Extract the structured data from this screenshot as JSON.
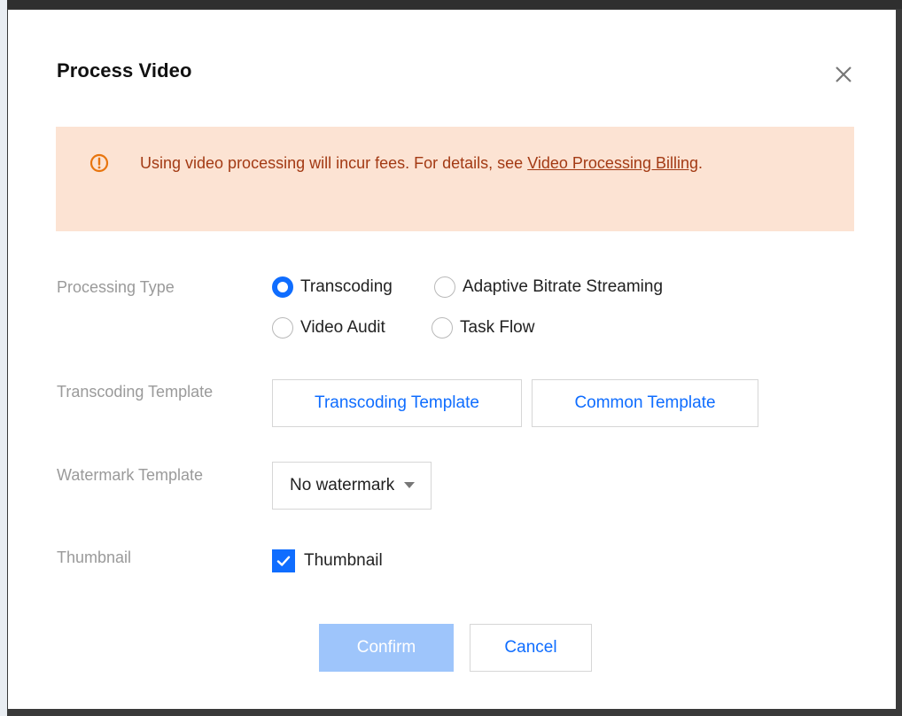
{
  "dialog": {
    "title": "Process Video",
    "close_icon": "close-icon"
  },
  "alert": {
    "icon": "warning-circle-icon",
    "text": "Using video processing will incur fees. For details, see ",
    "link_text": "Video Processing Billing",
    "suffix": ".",
    "color": "#a33a14",
    "background": "#fce3d3"
  },
  "processing_type": {
    "label": "Processing Type",
    "options": [
      {
        "label": "Transcoding",
        "selected": true
      },
      {
        "label": "Adaptive Bitrate Streaming",
        "selected": false
      },
      {
        "label": "Video Audit",
        "selected": false
      },
      {
        "label": "Task Flow",
        "selected": false
      }
    ]
  },
  "transcoding_template": {
    "label": "Transcoding Template",
    "buttons": [
      "Transcoding Template",
      "Common Template"
    ]
  },
  "watermark_template": {
    "label": "Watermark Template",
    "value": "No watermark"
  },
  "thumbnail": {
    "label": "Thumbnail",
    "checkbox_label": "Thumbnail",
    "checked": true
  },
  "footer": {
    "confirm_label": "Confirm",
    "cancel_label": "Cancel"
  },
  "colors": {
    "accent": "#0f6dff",
    "confirm_disabled": "#9ec5fb"
  }
}
